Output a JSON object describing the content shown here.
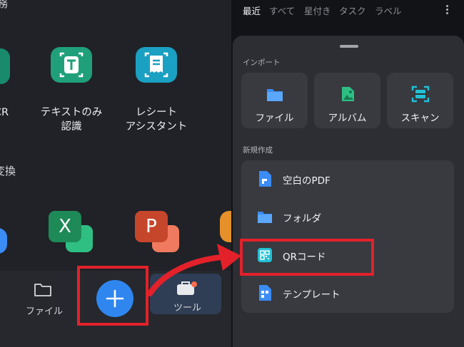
{
  "left": {
    "section1_fragment": "務",
    "section2_fragment": "変換",
    "features": [
      {
        "label_line1": "CR",
        "label_line2": ""
      },
      {
        "label_line1": "テキストのみ",
        "label_line2": "認識"
      },
      {
        "label_line1": "レシート",
        "label_line2": "アシスタント"
      }
    ],
    "bottom_nav": {
      "files_label": "ファイル",
      "tools_label": "ツール"
    }
  },
  "right": {
    "tabs": [
      "最近",
      "すべて",
      "星付き",
      "タスク",
      "ラベル"
    ],
    "more_icon": "kebab-menu-icon",
    "import_title": "インポート",
    "import_items": [
      {
        "label": "ファイル",
        "icon": "folder-icon"
      },
      {
        "label": "アルバム",
        "icon": "album-icon"
      },
      {
        "label": "スキャン",
        "icon": "scan-icon"
      }
    ],
    "create_title": "新規作成",
    "create_items": [
      {
        "label": "空白のPDF",
        "icon": "blank-pdf-icon"
      },
      {
        "label": "フォルダ",
        "icon": "folder-icon"
      },
      {
        "label": "QRコード",
        "icon": "qr-code-icon"
      },
      {
        "label": "テンプレート",
        "icon": "template-icon"
      }
    ]
  },
  "colors": {
    "highlight": "#e3212a",
    "accent": "#3b8cf5",
    "green_icon": "#1fa07a",
    "excel_green": "#1e8a57",
    "ppt_red": "#c6462c"
  }
}
